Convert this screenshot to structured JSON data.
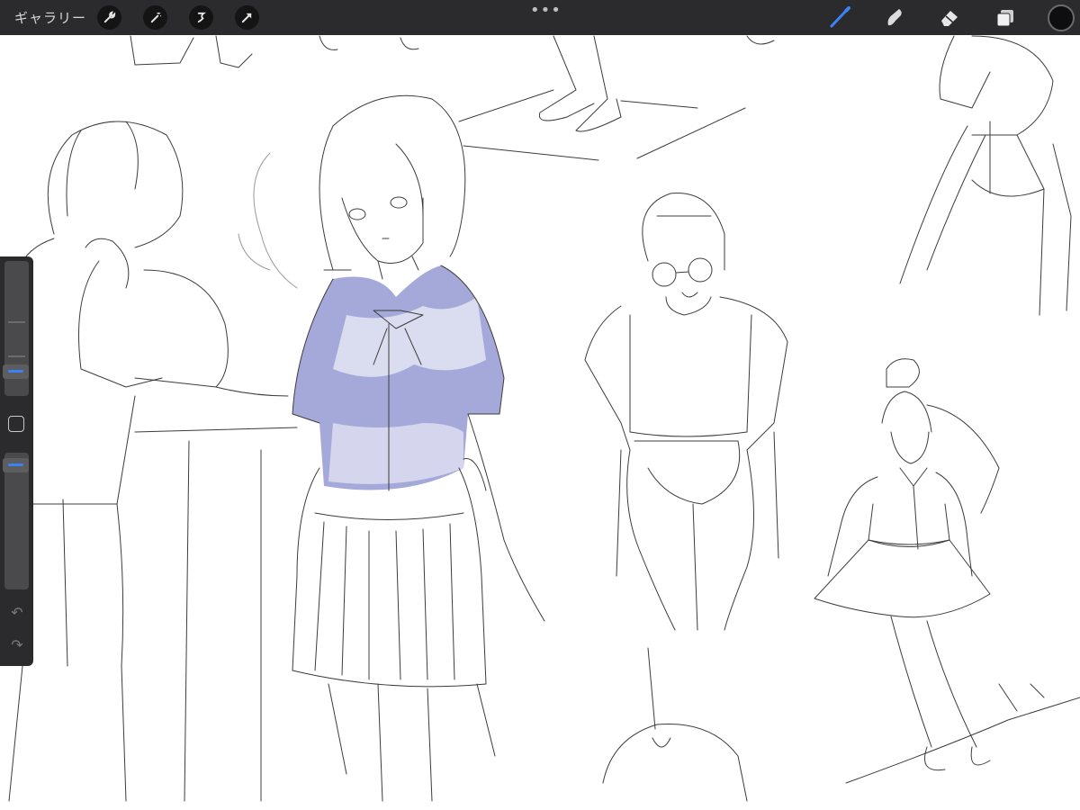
{
  "toolbar": {
    "gallery_label": "ギャラリー",
    "more_label": "•••",
    "left_tools": [
      {
        "icon": "wrench-icon"
      },
      {
        "icon": "magic-wand-icon"
      },
      {
        "icon": "selection-icon"
      },
      {
        "icon": "transform-arrow-icon"
      }
    ],
    "right_tools": [
      {
        "icon": "brush-icon",
        "active": true
      },
      {
        "icon": "smudge-icon",
        "active": false
      },
      {
        "icon": "eraser-icon",
        "active": false
      },
      {
        "icon": "layers-icon",
        "active": false
      }
    ],
    "current_color": "#0e0e10",
    "accent_color": "#3b82f6"
  },
  "sidebar": {
    "brush_size_level": 0.34,
    "opacity_level": 0.1,
    "undo_icon": "↶",
    "redo_icon": "↷"
  },
  "canvas": {
    "line_color": "#3c3c3c",
    "shade_color": "#8f93d0"
  }
}
